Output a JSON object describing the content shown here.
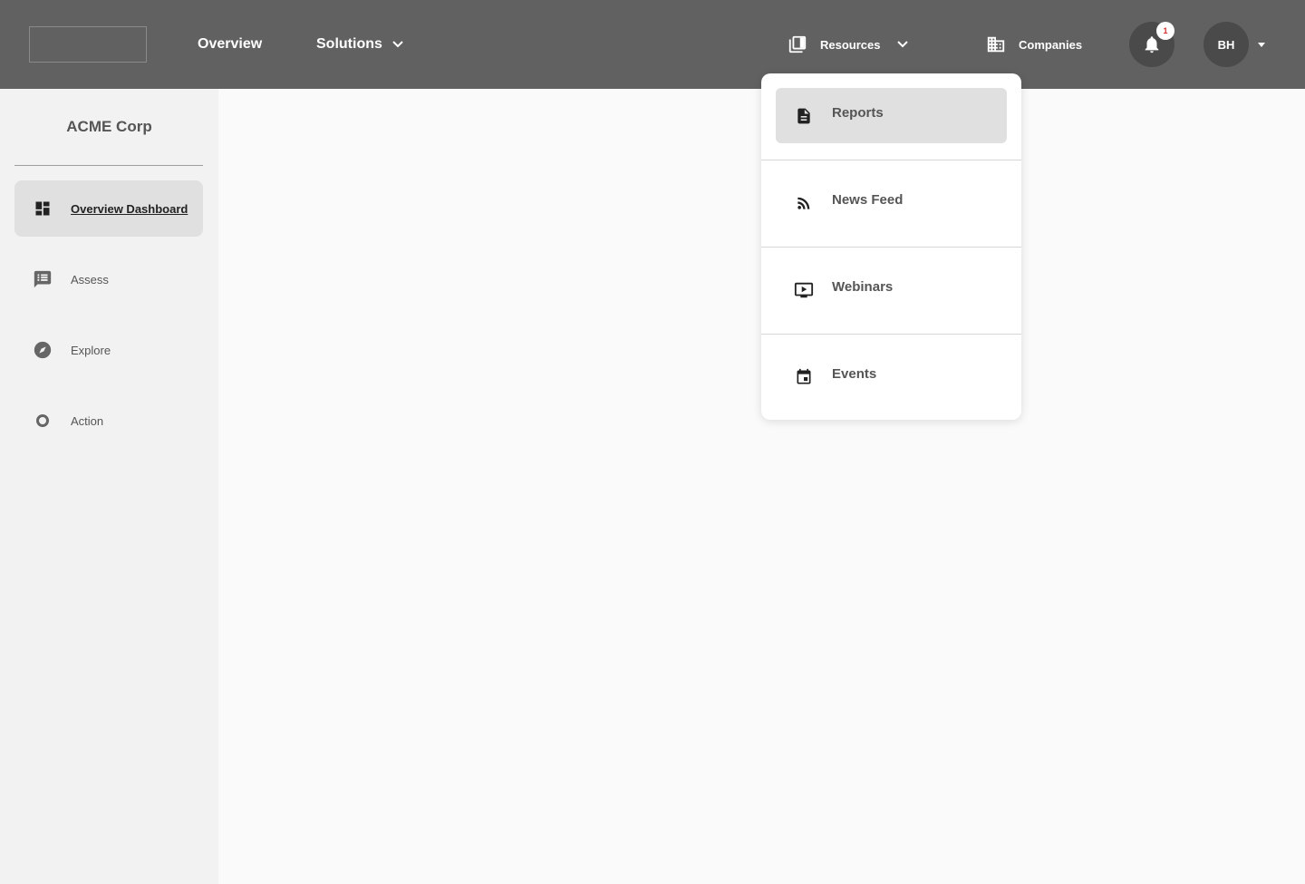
{
  "header": {
    "nav": {
      "overview": "Overview",
      "solutions": "Solutions",
      "resources": "Resources",
      "companies": "Companies"
    },
    "notifications": {
      "count": "1",
      "icon": "bell-icon"
    },
    "user": {
      "initials": "BH"
    }
  },
  "sidebar": {
    "company": "ACME Corp",
    "items": [
      {
        "label": "Overview Dashboard",
        "icon": "dashboard-icon",
        "active": true
      },
      {
        "label": "Assess",
        "icon": "comment-list-icon",
        "active": false
      },
      {
        "label": "Explore",
        "icon": "compass-icon",
        "active": false
      },
      {
        "label": "Action",
        "icon": "circle-icon",
        "active": false
      }
    ]
  },
  "resources_menu": {
    "items": [
      {
        "label": "Reports",
        "icon": "document-icon",
        "highlighted": true
      },
      {
        "label": "News Feed",
        "icon": "rss-icon",
        "highlighted": false
      },
      {
        "label": "Webinars",
        "icon": "video-play-icon",
        "highlighted": false
      },
      {
        "label": "Events",
        "icon": "calendar-icon",
        "highlighted": false
      }
    ]
  },
  "colors": {
    "topbar": "#616161",
    "sidebar": "#f2f2f2",
    "active_item": "#e0e0e0",
    "badge_text": "#d32f2f"
  }
}
